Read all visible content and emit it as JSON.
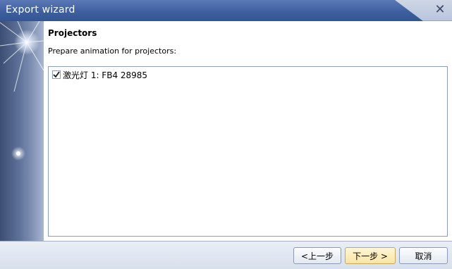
{
  "window": {
    "title": "Export wizard",
    "close_glyph": "✕"
  },
  "page": {
    "heading": "Projectors",
    "subheading": "Prepare animation for projectors:"
  },
  "projectors": [
    {
      "label": "激光灯 1: FB4 28985",
      "checked": true
    }
  ],
  "buttons": {
    "back": "<上一步",
    "next": "下一步 >",
    "cancel": "取消"
  },
  "colors": {
    "title_bar": "#3e5f9f",
    "primary_button": "#fbe3a3",
    "side_panel": "#5f7299"
  }
}
